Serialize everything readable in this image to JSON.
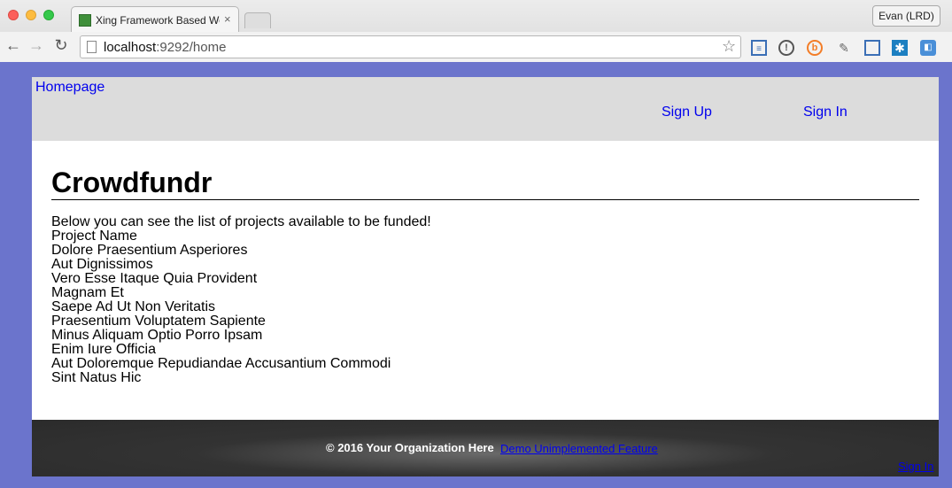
{
  "browser": {
    "tab_title": "Xing Framework Based Web",
    "tab_close": "×",
    "profile_label": "Evan (LRD)",
    "url_host": "localhost",
    "url_rest": ":9292/home",
    "back_glyph": "←",
    "forward_glyph": "→",
    "reload_glyph": "↻",
    "star_glyph": "☆",
    "extensions": [
      "list-icon",
      "info-icon",
      "b-icon",
      "puzzle-icon",
      "window-icon",
      "grid-icon",
      "keyboard-icon"
    ]
  },
  "header": {
    "home_label": "Homepage",
    "signup_label": "Sign Up",
    "signin_label": "Sign In"
  },
  "main": {
    "title": "Crowdfundr",
    "intro": "Below you can see the list of projects available to be funded!",
    "list_header": "Project Name",
    "projects": [
      "Dolore Praesentium Asperiores",
      "Aut Dignissimos",
      "Vero Esse Itaque Quia Provident",
      "Magnam Et",
      "Saepe Ad Ut Non Veritatis",
      "Praesentium Voluptatem Sapiente",
      "Minus Aliquam Optio Porro Ipsam",
      "Enim Iure Officia",
      "Aut Doloremque Repudiandae Accusantium Commodi",
      "Sint Natus Hic"
    ]
  },
  "footer": {
    "copyright": "© 2016 Your Organization Here",
    "demo_link": "Demo Unimplemented Feature",
    "signin_label": "Sign In"
  },
  "colors": {
    "background": "#6b74cc",
    "header_bg": "#dcdcdc",
    "link": "#0000ee",
    "footer_bg": "#2b2b2b"
  }
}
